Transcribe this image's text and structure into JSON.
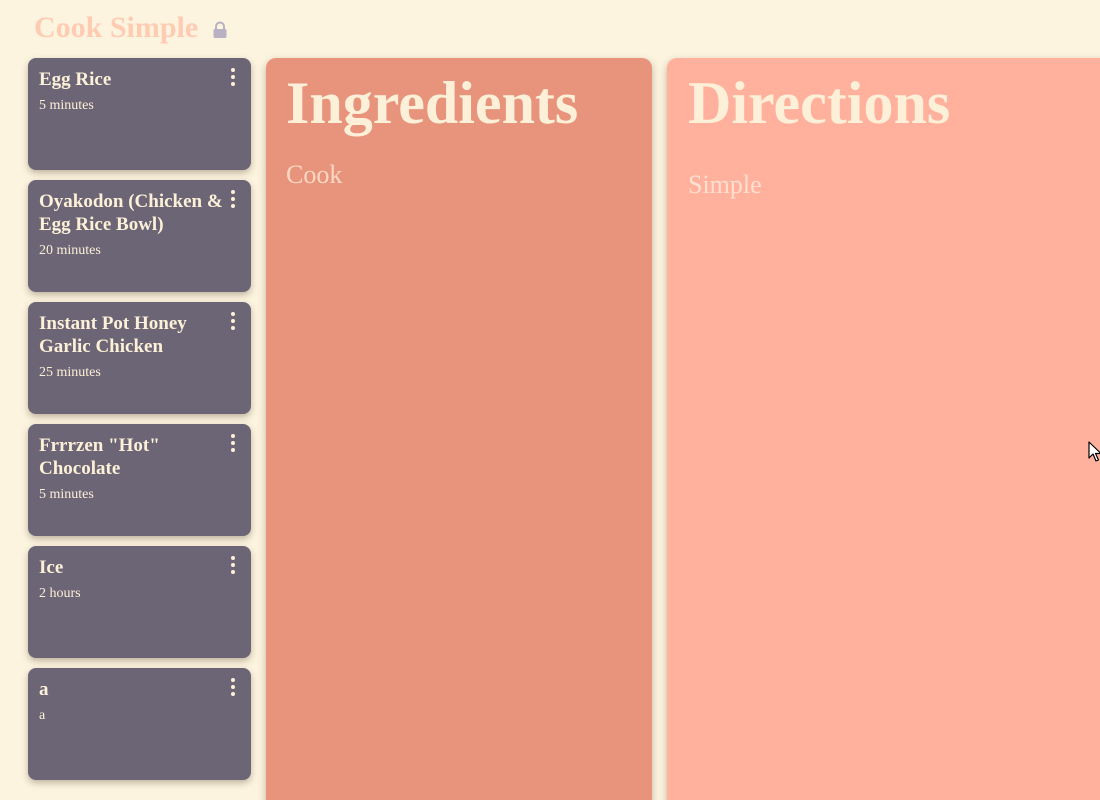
{
  "app": {
    "title": "Cook Simple",
    "lock_icon": "lock-icon",
    "colors": {
      "background": "#fcf4df",
      "title": "#ffcbb3",
      "card": "#6b6575",
      "ingredients_panel": "#e8947c",
      "directions_panel": "#ffb19d",
      "text_light": "#fdf0d8"
    }
  },
  "recipes": [
    {
      "title": "Egg Rice",
      "time": "5 minutes"
    },
    {
      "title": "Oyakodon (Chicken & Egg Rice Bowl)",
      "time": "20 minutes"
    },
    {
      "title": "Instant Pot Honey Garlic Chicken",
      "time": "25 minutes"
    },
    {
      "title": "Frrrzen \"Hot\" Chocolate",
      "time": "5 minutes"
    },
    {
      "title": "Ice",
      "time": "2 hours"
    },
    {
      "title": "a",
      "time": "a"
    }
  ],
  "ingredients": {
    "heading": "Ingredients",
    "body": "Cook"
  },
  "directions": {
    "heading": "Directions",
    "body": "Simple"
  }
}
